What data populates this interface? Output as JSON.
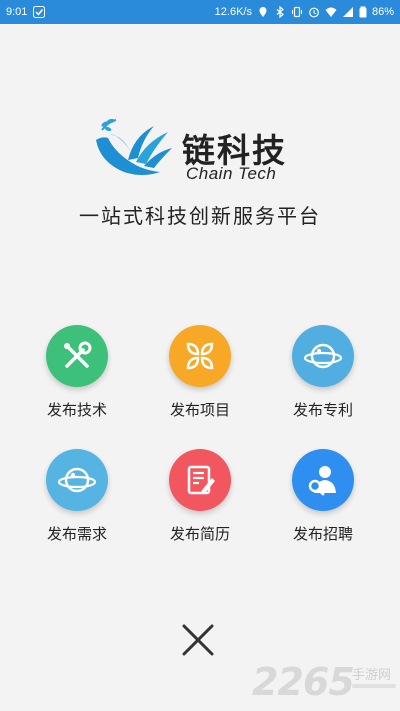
{
  "status_bar": {
    "time": "9:01",
    "net_speed": "12.6K/s",
    "battery": "86%"
  },
  "brand": {
    "name_cn": "链科技",
    "name_en": "Chain Tech",
    "slogan": "一站式科技创新服务平台"
  },
  "actions": [
    {
      "label": "发布技术",
      "icon": "tools-icon",
      "color": "#3cc07a"
    },
    {
      "label": "发布项目",
      "icon": "grid-icon",
      "color": "#f6a826"
    },
    {
      "label": "发布专利",
      "icon": "planet-icon",
      "color": "#52aee0"
    },
    {
      "label": "发布需求",
      "icon": "planet-icon",
      "color": "#56b4e3"
    },
    {
      "label": "发布简历",
      "icon": "resume-icon",
      "color": "#f2565e"
    },
    {
      "label": "发布招聘",
      "icon": "recruit-icon",
      "color": "#2f8ff0"
    }
  ],
  "watermark": {
    "number": "2265",
    "site": "手游网"
  }
}
